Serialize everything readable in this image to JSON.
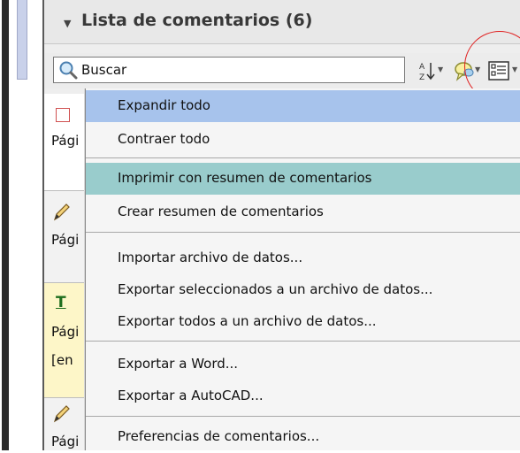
{
  "panel": {
    "title": "Lista de comentarios (6)",
    "collapse_glyph": "▼"
  },
  "toolbar": {
    "search_value": "Buscar",
    "icons": [
      "search-icon",
      "sort-icon",
      "comment-filter-icon",
      "options-icon"
    ],
    "dropdown_glyph": "▼"
  },
  "list": {
    "rows": [
      {
        "icon": "sticky-note-icon",
        "text": "Pági"
      },
      {
        "icon": "pencil-icon",
        "text": "Pági"
      },
      {
        "icon": "text-edit-icon",
        "icon_glyph": "T",
        "text": "Pági",
        "text2": "[en"
      },
      {
        "icon": "pencil-icon",
        "text": "Pági"
      }
    ]
  },
  "menu": {
    "items": [
      {
        "label": "Expandir todo",
        "state": "hover"
      },
      {
        "label": "Contraer todo"
      },
      {
        "label": "Imprimir con resumen de comentarios",
        "state": "selected"
      },
      {
        "label": "Crear resumen de comentarios"
      },
      {
        "label": "Importar archivo de datos..."
      },
      {
        "label": "Exportar seleccionados a un archivo de datos..."
      },
      {
        "label": "Exportar todos a un archivo de datos..."
      },
      {
        "label": "Exportar a Word..."
      },
      {
        "label": "Exportar a AutoCAD..."
      },
      {
        "label": "Preferencias de comentarios..."
      }
    ]
  },
  "colors": {
    "hover_highlight": "#a7c3ec",
    "selected_highlight": "#99cccc",
    "annotation_circle": "#e02020"
  }
}
